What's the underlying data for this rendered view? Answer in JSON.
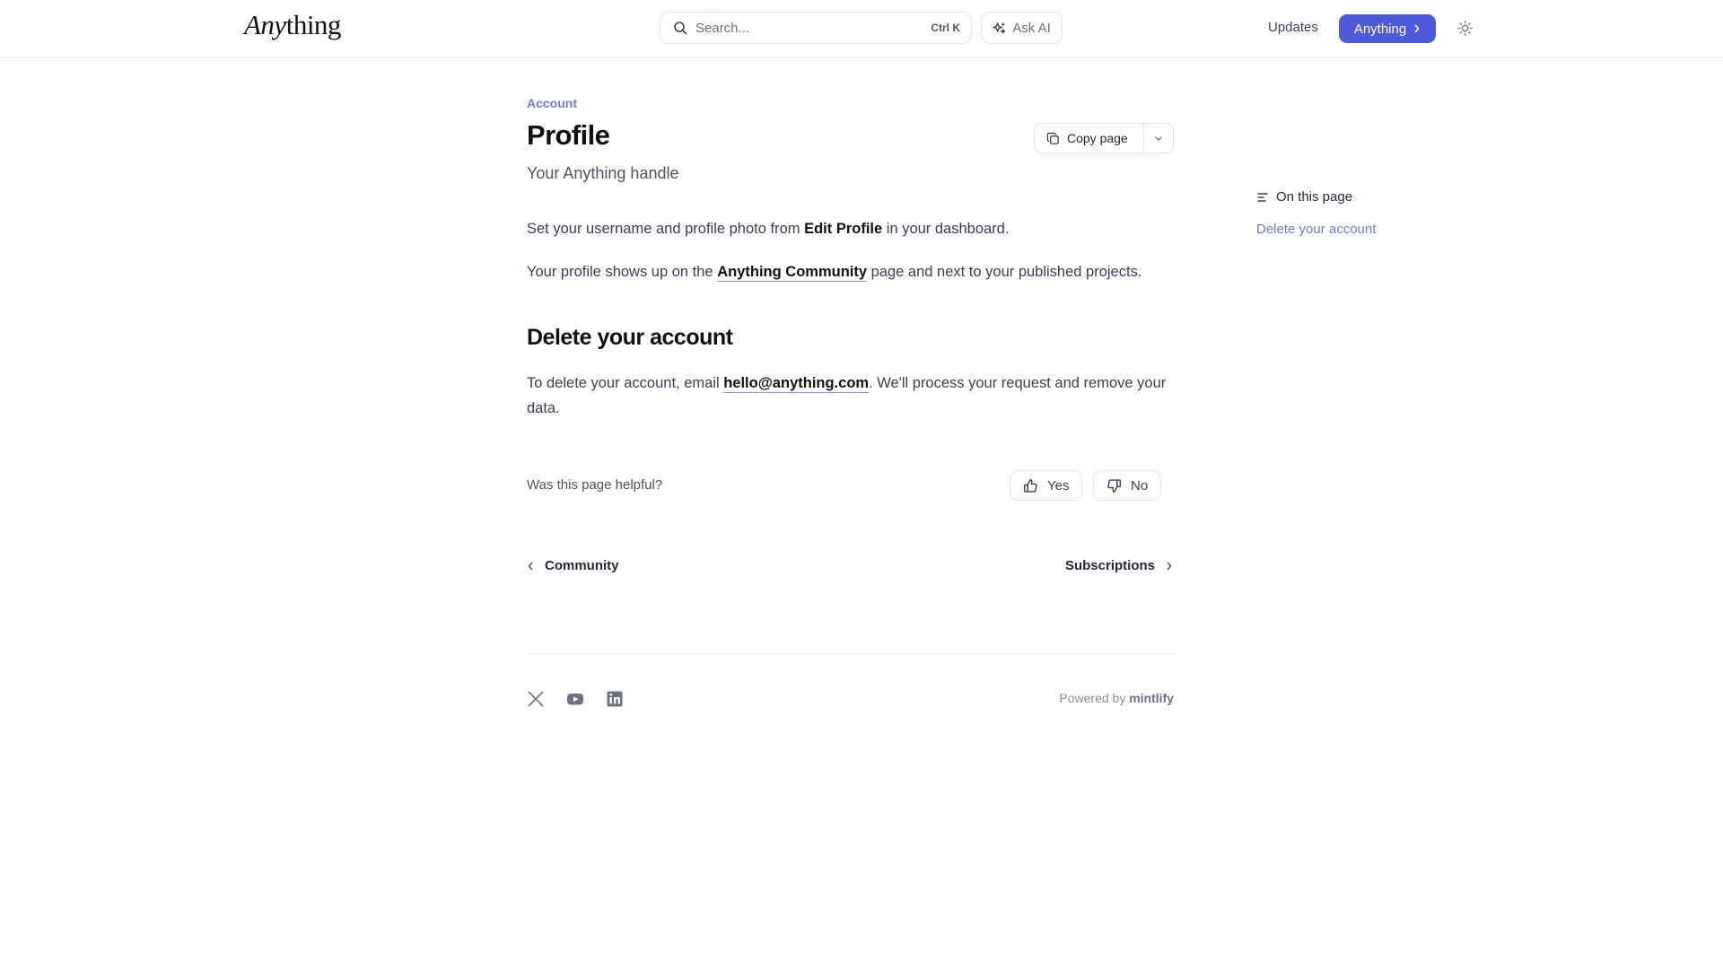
{
  "header": {
    "logo_part1": "Any",
    "logo_part2": "thing",
    "search_placeholder": "Search...",
    "search_shortcut": "Ctrl K",
    "ask_ai_label": "Ask AI",
    "updates_label": "Updates",
    "cta_label": "Anything"
  },
  "page": {
    "eyebrow": "Account",
    "title": "Profile",
    "subtitle": "Your Anything handle",
    "copy_label": "Copy page",
    "p1_pre": "Set your username and profile photo from ",
    "p1_bold": "Edit Profile",
    "p1_post": " in your dashboard.",
    "p2_pre": "Your profile shows up on the ",
    "p2_link": "Anything Community",
    "p2_post": " page and next to your published projects.",
    "section_heading": "Delete your account",
    "p3_pre": "To delete your account, email ",
    "p3_link": "hello@anything.com",
    "p3_post": ". We'll process your request and remove your data."
  },
  "feedback": {
    "question": "Was this page helpful?",
    "yes": "Yes",
    "no": "No"
  },
  "pagination": {
    "prev": "Community",
    "next": "Subscriptions"
  },
  "footer": {
    "powered_prefix": "Powered by ",
    "powered_brand": "mintlify",
    "social": [
      "x-icon",
      "youtube-icon",
      "linkedin-icon"
    ]
  },
  "toc": {
    "heading": "On this page",
    "items": [
      "Delete your account"
    ]
  },
  "colors": {
    "accent": "#4f5ad8",
    "accent_light": "#6f78e0"
  }
}
